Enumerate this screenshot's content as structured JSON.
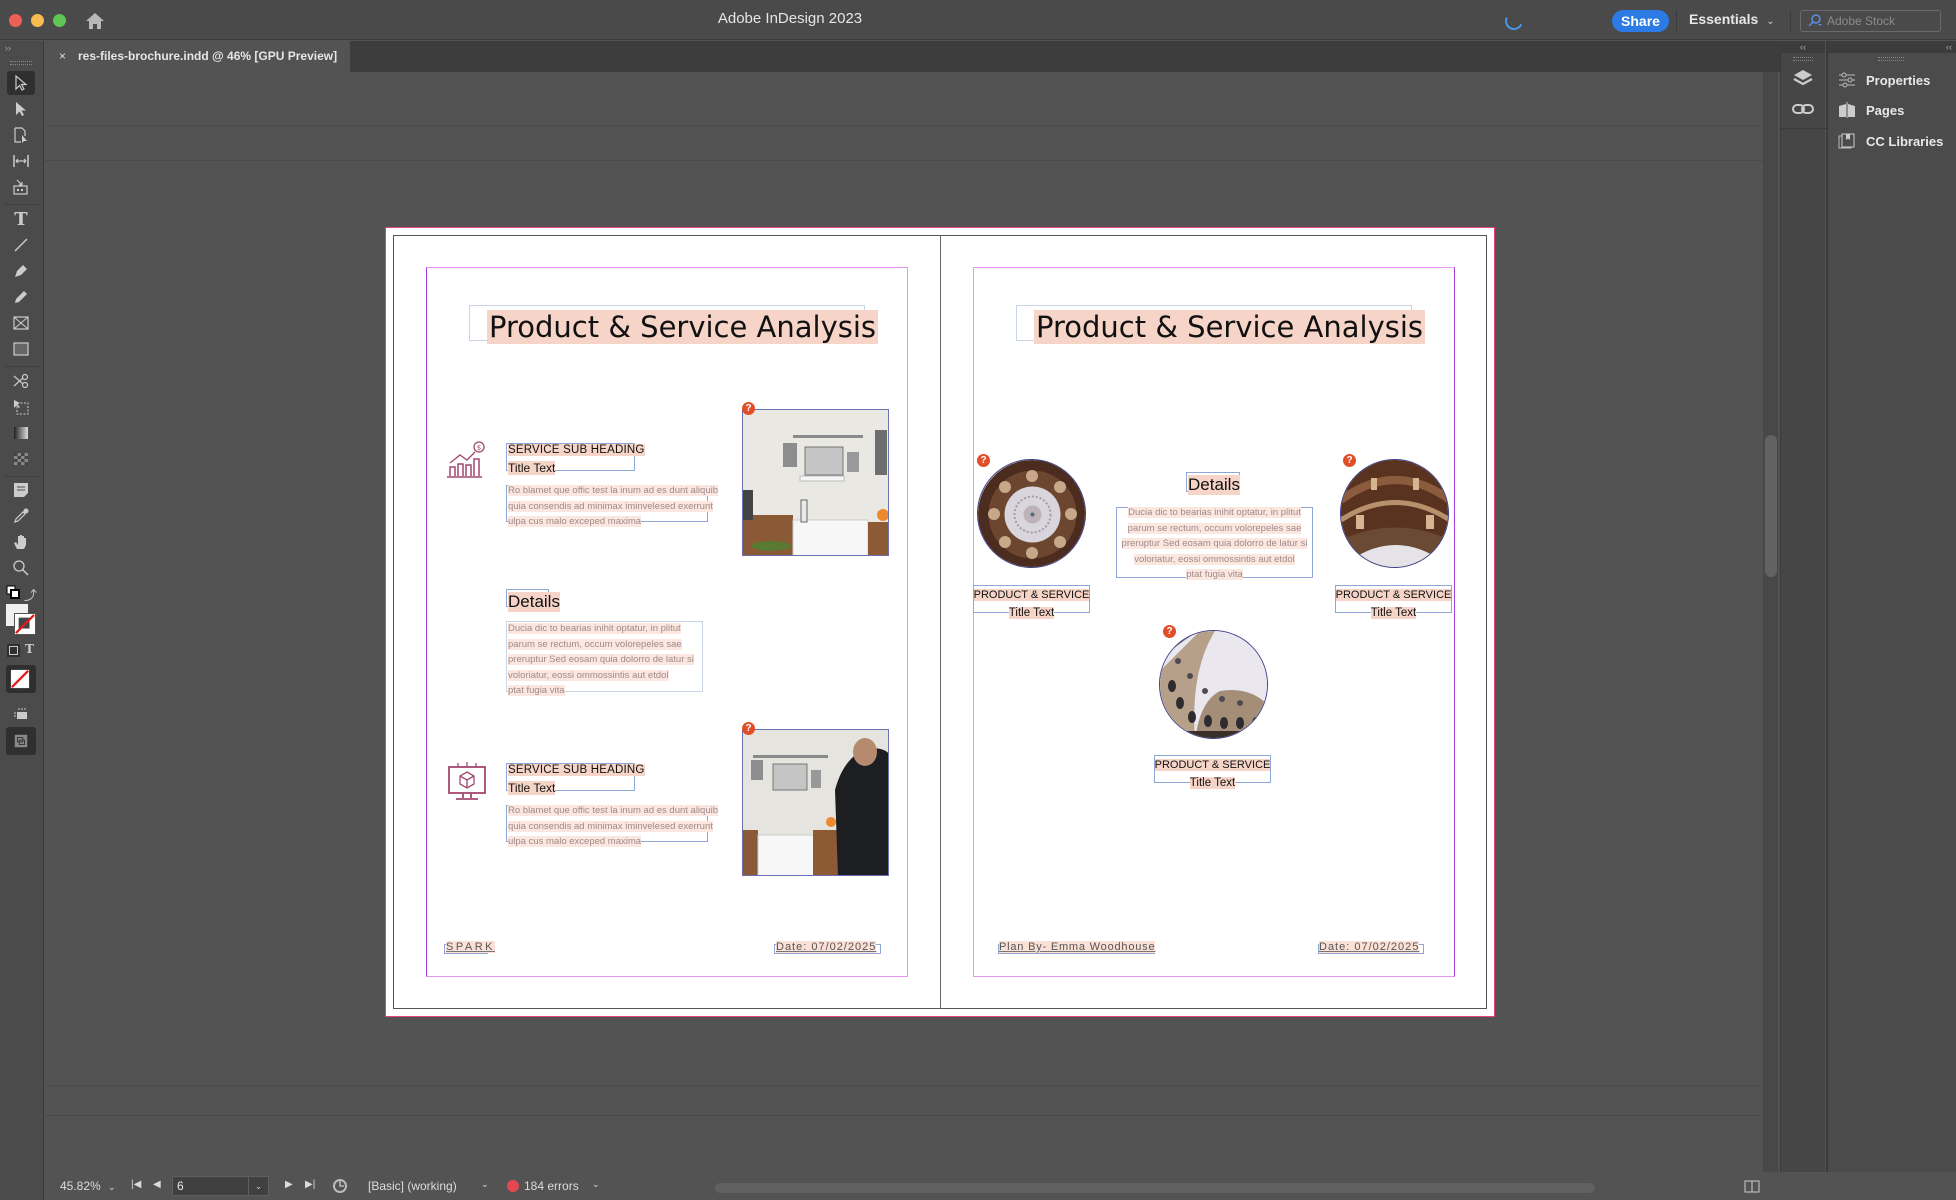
{
  "app": {
    "title": "Adobe InDesign 2023",
    "share_label": "Share",
    "workspace": "Essentials",
    "stock_search_placeholder": "Adobe Stock",
    "colors": {
      "share": "#2c7be5",
      "guide_margin": "#e994f2",
      "bleed": "#e8427c",
      "text_highlight": "#f6d5c8",
      "error": "#e34850"
    }
  },
  "tab": {
    "close_label": "×",
    "label": "res-files-brochure.indd @ 46% [GPU Preview]"
  },
  "toolbar": {
    "tools": [
      "selection-tool",
      "direct-selection-tool",
      "page-tool",
      "gap-tool",
      "content-collector-tool",
      "type-tool",
      "line-tool",
      "pen-tool",
      "pencil-tool",
      "rectangle-frame-tool",
      "rectangle-tool",
      "scissors-tool",
      "free-transform-tool",
      "gradient-swatch-tool",
      "gradient-feather-tool",
      "note-tool",
      "eyedropper-tool",
      "hand-tool",
      "zoom-tool",
      "default-fill-stroke",
      "swap-fill-stroke",
      "fill-swatch",
      "stroke-swatch",
      "formatting-container",
      "formatting-text",
      "apply-none",
      "screen-mode",
      "view-mode"
    ],
    "type_glyph": "T"
  },
  "right_panel": {
    "items": [
      {
        "label": "Properties",
        "icon": "properties-icon"
      },
      {
        "label": "Pages",
        "icon": "pages-icon"
      },
      {
        "label": "CC Libraries",
        "icon": "cc-libraries-icon"
      }
    ],
    "dock_icons": [
      "layers-icon",
      "links-icon"
    ],
    "collapse_glyph": "‹‹"
  },
  "page_left": {
    "title": "Product & Service Analysis",
    "services": [
      {
        "sub_heading": "SERVICE SUB HEADING",
        "title": "Title Text",
        "body": [
          "Ro blamet que offic test la inum ad es dunt aliquib",
          "quia consendis ad minimax iminvelesed exerrunt",
          "ulpa cus malo exceped maxima"
        ],
        "icon": "growth-chart-dollar-icon"
      },
      {
        "sub_heading": "SERVICE SUB HEADING",
        "title": "Title Text",
        "body": [
          "Ro blamet que offic test la inum ad es dunt aliquib",
          "quia consendis ad minimax iminvelesed exerrunt",
          "ulpa cus malo exceped maxima"
        ],
        "icon": "monitor-cube-network-icon"
      }
    ],
    "details": {
      "heading": "Details",
      "body": [
        "Ducia dic to bearias inihit optatur, in plitut",
        "parum se rectum, occum volorepeles sae",
        "preruptur Sed eosam quia dolorro de latur si",
        "voloriatur, eossi ommossintis aut etdol",
        "ptat fugia vita"
      ]
    },
    "footer_left": "SPARK",
    "footer_right": "Date: 07/02/2025",
    "missing_link_glyph": "?"
  },
  "page_right": {
    "title": "Product & Service Analysis",
    "products": [
      {
        "label": "PRODUCT & SERVICE",
        "title": "Title Text"
      },
      {
        "label": "PRODUCT & SERVICE",
        "title": "Title Text"
      },
      {
        "label": "PRODUCT & SERVICE",
        "title": "Title Text"
      }
    ],
    "details": {
      "heading": "Details",
      "body": [
        "Ducia dic to bearias inihit optatur, in plitut",
        "parum se rectum, occum volorepeles sae",
        "preruptur Sed eosam quia dolorro de latur si",
        "voloriatur, eossi ommossintis aut etdol",
        "ptat fugia vita"
      ]
    },
    "footer_left": "Plan By- Emma Woodhouse",
    "footer_right": "Date: 07/02/2025"
  },
  "status": {
    "zoom": "45.82%",
    "page": "6",
    "preflight_profile": "[Basic] (working)",
    "errors": "184 errors"
  }
}
